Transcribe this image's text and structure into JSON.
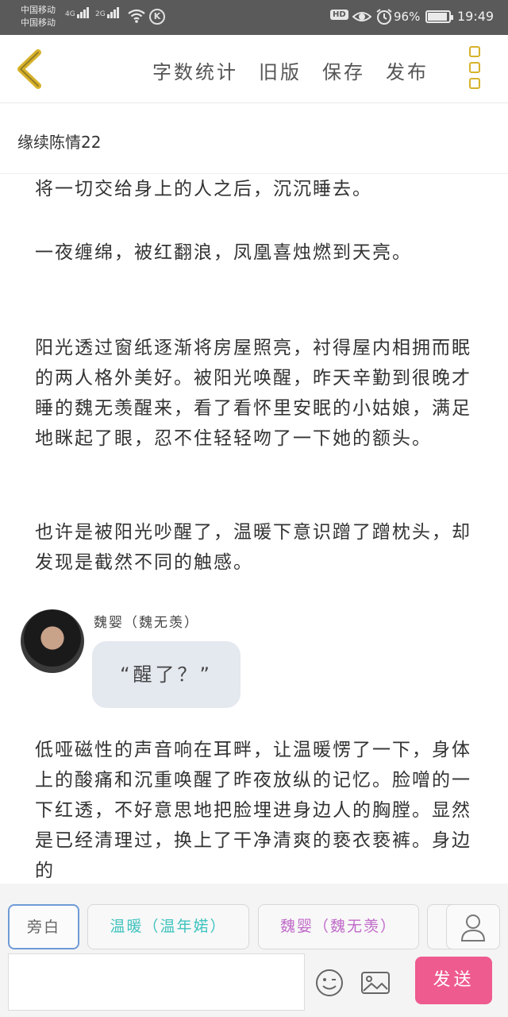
{
  "status_bar": {
    "carrier_1": "中国移动",
    "carrier_2": "中国移动",
    "network_1": "4G",
    "network_2": "2G",
    "battery": "96%",
    "time": "19:49"
  },
  "header": {
    "actions": [
      "字数统计",
      "旧版",
      "保存",
      "发布"
    ],
    "accent_color": "#d7b22a"
  },
  "doc_title": "缘续陈情22",
  "content": {
    "paragraphs": [
      "将一切交给身上的人之后，沉沉睡去。",
      "一夜缠绵，被红翻浪，凤凰喜烛燃到天亮。",
      "阳光透过窗纸逐渐将房屋照亮，衬得屋内相拥而眠的两人格外美好。被阳光唤醒，昨天辛勤到很晚才睡的魏无羡醒来，看了看怀里安眠的小姑娘，满足地眯起了眼，忍不住轻轻吻了一下她的额头。",
      "也许是被阳光吵醒了，温暖下意识蹭了蹭枕头，却发现是截然不同的触感。",
      "低哑磁性的声音响在耳畔，让温暖愣了一下，身体上的酸痛和沉重唤醒了昨夜放纵的记忆。脸噌的一下红透，不好意思地把脸埋进身边人的胸膛。显然是已经清理过，换上了干净清爽的亵衣亵裤。身边的"
    ],
    "dialog": {
      "speaker": "魏婴（魏无羡）",
      "text": "“醒了？”"
    }
  },
  "composer": {
    "roles": [
      {
        "label": "旁白",
        "color": "#666666"
      },
      {
        "label": "温暖（温年婼）",
        "color": "#3fc3bf"
      },
      {
        "label": "魏婴（魏无羡）",
        "color": "#c06ac9"
      }
    ],
    "send_label": "发送",
    "send_color": "#ee5b8f"
  }
}
